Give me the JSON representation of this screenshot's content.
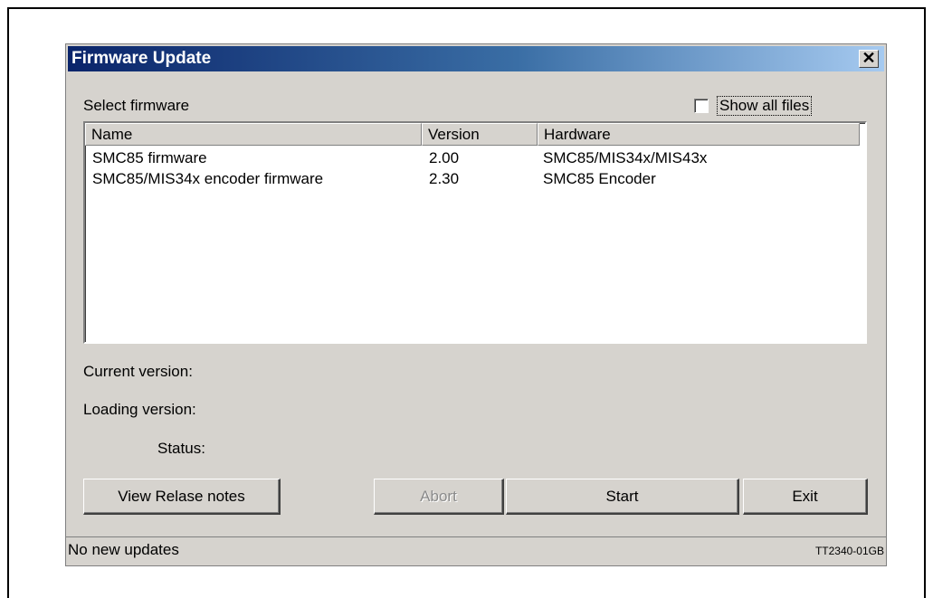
{
  "window": {
    "title": "Firmware Update",
    "close_glyph": "✕"
  },
  "select_label": "Select firmware",
  "show_all_files": {
    "label": "Show all files",
    "checked": false
  },
  "list": {
    "columns": [
      "Name",
      "Version",
      "Hardware"
    ],
    "rows": [
      {
        "name": "SMC85 firmware",
        "version": "2.00",
        "hardware": "SMC85/MIS34x/MIS43x"
      },
      {
        "name": "SMC85/MIS34x encoder firmware",
        "version": "2.30",
        "hardware": "SMC85 Encoder"
      }
    ]
  },
  "labels": {
    "current_version": "Current version:",
    "loading_version": "Loading version:",
    "status": "Status:"
  },
  "buttons": {
    "view_release_notes": "View Relase notes",
    "abort": "Abort",
    "start": "Start",
    "exit": "Exit"
  },
  "statusbar": {
    "text": "No new updates"
  },
  "figure_ref": "TT2340-01GB",
  "colors": {
    "titlebar_start": "#0a246a",
    "titlebar_end": "#a6caf0",
    "dialog_bg": "#d6d3ce"
  },
  "icons": {
    "close": "close-icon"
  }
}
